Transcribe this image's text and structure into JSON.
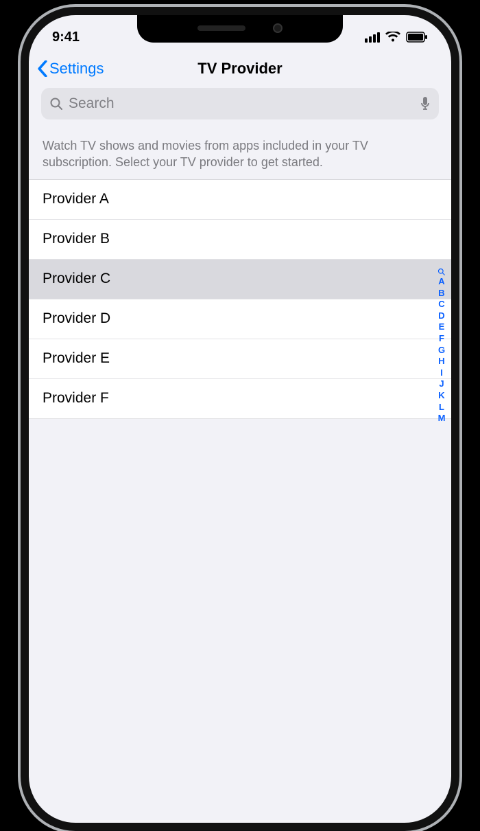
{
  "status": {
    "time": "9:41"
  },
  "nav": {
    "back_label": "Settings",
    "title": "TV Provider"
  },
  "search": {
    "placeholder": "Search"
  },
  "description": "Watch TV shows and movies from apps included in your TV subscription. Select your TV provider to get started.",
  "providers": [
    {
      "name": "Provider A",
      "selected": false
    },
    {
      "name": "Provider B",
      "selected": false
    },
    {
      "name": "Provider C",
      "selected": true
    },
    {
      "name": "Provider D",
      "selected": false
    },
    {
      "name": "Provider E",
      "selected": false
    },
    {
      "name": "Provider F",
      "selected": false
    }
  ],
  "index": [
    "A",
    "B",
    "C",
    "D",
    "E",
    "F",
    "G",
    "H",
    "I",
    "J",
    "K",
    "L",
    "M"
  ]
}
